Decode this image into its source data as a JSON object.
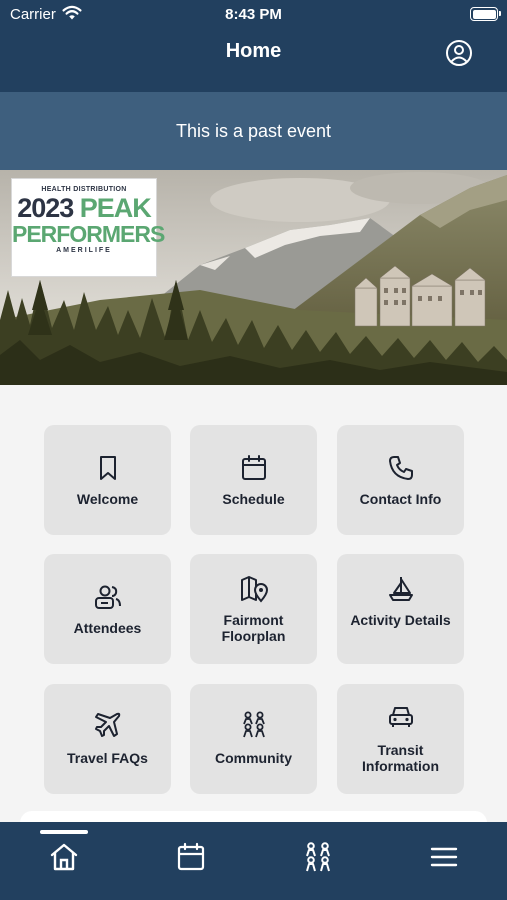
{
  "status_bar": {
    "carrier": "Carrier",
    "time": "8:43 PM"
  },
  "nav": {
    "title": "Home",
    "profile_icon": "user-circle-icon"
  },
  "past_event_banner": "This is a past event",
  "hero": {
    "logo_line1": "HEALTH DISTRIBUTION",
    "logo_year": "2023",
    "logo_peak": "PEAK",
    "logo_performers": "PERFORMERS",
    "logo_brand": "AMERILIFE"
  },
  "tiles": [
    {
      "label": "Welcome",
      "icon": "bookmark-icon"
    },
    {
      "label": "Schedule",
      "icon": "calendar-icon"
    },
    {
      "label": "Contact Info",
      "icon": "phone-icon"
    },
    {
      "label": "Attendees",
      "icon": "attendees-icon"
    },
    {
      "label": "Fairmont Floorplan",
      "icon": "map-pin-icon"
    },
    {
      "label": "Activity Details",
      "icon": "sailboat-icon"
    },
    {
      "label": "Travel FAQs",
      "icon": "airplane-icon"
    },
    {
      "label": "Community",
      "icon": "community-icon"
    },
    {
      "label": "Transit Information",
      "icon": "car-icon"
    }
  ],
  "tab_bar": [
    {
      "icon": "home-icon",
      "selected": true
    },
    {
      "icon": "calendar-icon",
      "selected": false
    },
    {
      "icon": "community-icon",
      "selected": false
    },
    {
      "icon": "menu-icon",
      "selected": false
    }
  ],
  "colors": {
    "nav": "#22405f",
    "banner": "#3e5f7e",
    "tile": "#e3e3e3",
    "logo_green": "#5ba772"
  }
}
